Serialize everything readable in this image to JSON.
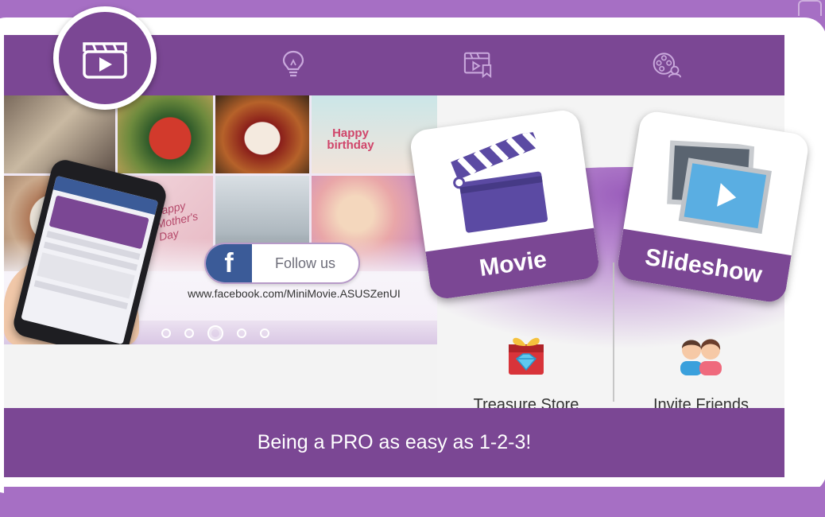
{
  "tabs": [
    {
      "id": "movie",
      "icon": "clapperboard-icon",
      "active": true
    },
    {
      "id": "tips",
      "icon": "lightbulb-icon",
      "active": false
    },
    {
      "id": "gallery",
      "icon": "video-bookmark-icon",
      "active": false
    },
    {
      "id": "reel",
      "icon": "film-reel-user-icon",
      "active": false
    }
  ],
  "banner": {
    "follow_label": "Follow us",
    "facebook_glyph": "f",
    "url": "www.facebook.com/MiniMovie.ASUSZenUI",
    "slide_count": 5,
    "active_slide": 3,
    "photo_texts": {
      "birthday": "Happy birthday",
      "mothers_day": "Happy Mother's Day"
    }
  },
  "cards": {
    "movie_label": "Movie",
    "slideshow_label": "Slideshow"
  },
  "shortcuts": {
    "store_label": "Treasure Store",
    "invite_label": "Invite Friends"
  },
  "promo": {
    "text": "Being a PRO as easy as 1-2-3!"
  },
  "colors": {
    "primary_purple": "#7b4794",
    "light_purple": "#a66fc4",
    "facebook_blue": "#3b5b98"
  }
}
